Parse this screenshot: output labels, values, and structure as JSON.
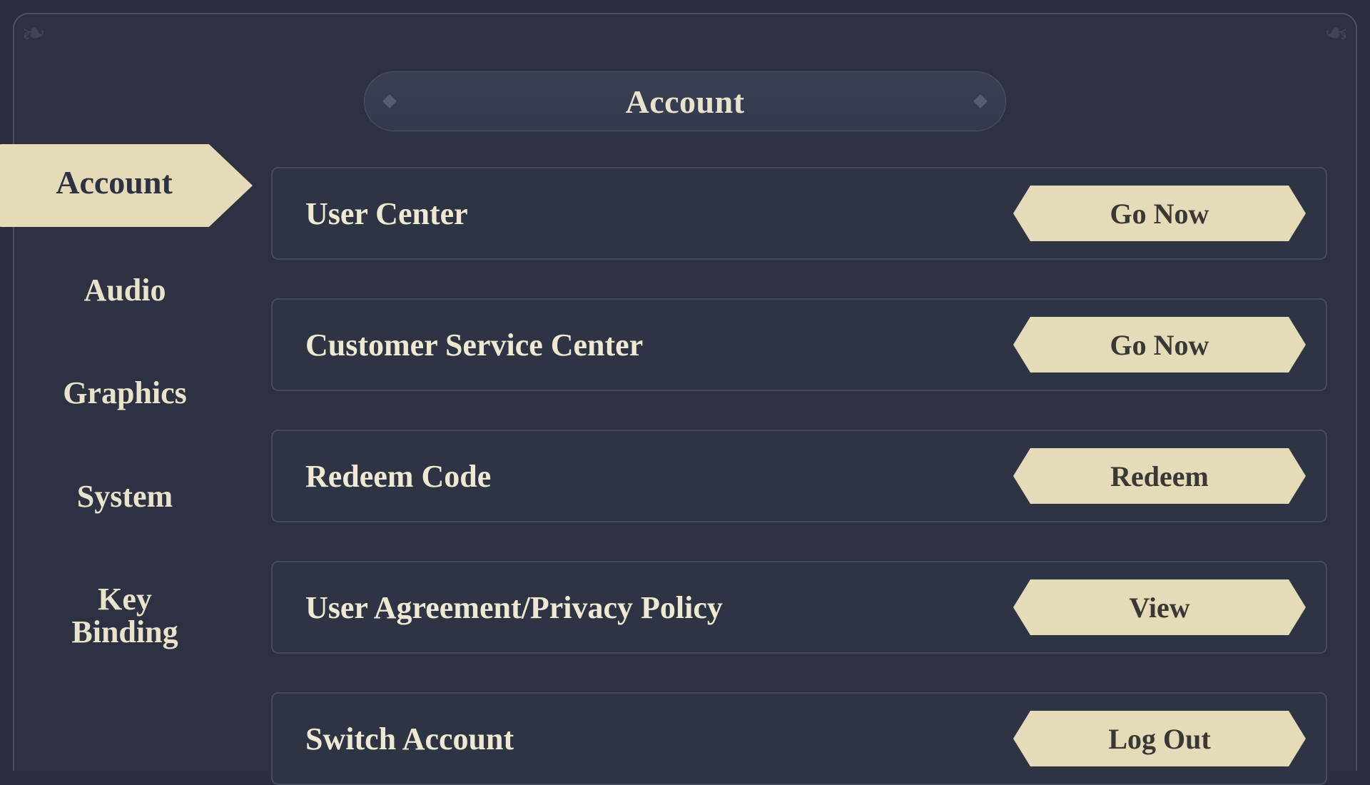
{
  "header": {
    "title": "Account"
  },
  "sidebar": {
    "tabs": [
      {
        "label": "Account",
        "active": true
      },
      {
        "label": "Audio"
      },
      {
        "label": "Graphics"
      },
      {
        "label": "System"
      },
      {
        "label": "Key\nBinding"
      }
    ]
  },
  "rows": [
    {
      "label": "User Center",
      "button": "Go Now"
    },
    {
      "label": "Customer Service Center",
      "button": "Go Now"
    },
    {
      "label": "Redeem Code",
      "button": "Redeem"
    },
    {
      "label": "User Agreement/Privacy Policy",
      "button": "View"
    },
    {
      "label": "Switch Account",
      "button": "Log Out"
    }
  ]
}
